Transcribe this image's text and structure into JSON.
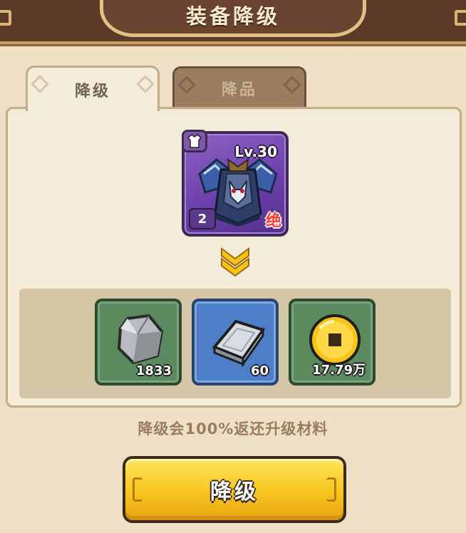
{
  "header": {
    "title": "装备降级"
  },
  "tabs": [
    {
      "label": "降级",
      "active": true
    },
    {
      "label": "降品",
      "active": false
    }
  ],
  "equipment": {
    "icon": "armor-icon",
    "type_icon": "chest-armor-icon",
    "level": "Lv.30",
    "stars": "2",
    "rarity": "绝",
    "frame_color": "#7a4fb8"
  },
  "materials": [
    {
      "icon": "stone-icon",
      "count": "1833",
      "frame_color": "#5a8a5e"
    },
    {
      "icon": "iron-ingot-icon",
      "count": "60",
      "frame_color": "#4f7ec8"
    },
    {
      "icon": "gold-coin-icon",
      "count": "17.79万",
      "frame_color": "#5a8a5e"
    }
  ],
  "note": "降级会100%返还升级材料",
  "action": {
    "label": "降级",
    "color": "#f7c51e"
  }
}
